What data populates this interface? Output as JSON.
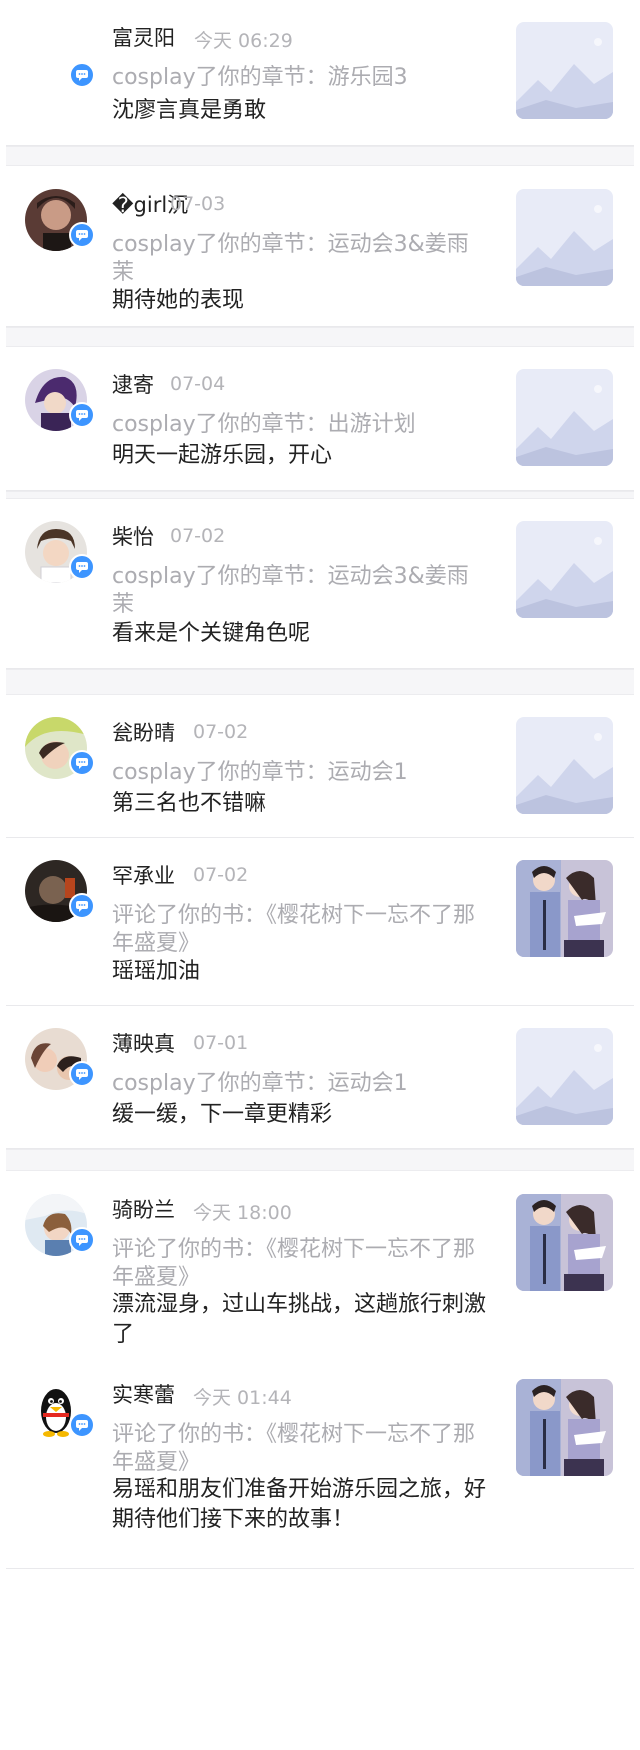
{
  "notifications": [
    {
      "name": "富灵阳",
      "time": "今天 06:29",
      "action": "cosplay了你的章节：游乐园3",
      "text": "沈廖言真是勇敢",
      "avatar": "none",
      "thumb": "placeholder"
    },
    {
      "name": "�girl沉",
      "time": "07-03",
      "action": "cosplay了你的章节：运动会3&姜雨茉",
      "text": "期待她的表现",
      "avatar": "photo",
      "thumb": "placeholder"
    },
    {
      "name": "逮寄",
      "time": "07-04",
      "action": "cosplay了你的章节：出游计划",
      "text": "明天一起游乐园，开心",
      "avatar": "photo",
      "thumb": "placeholder"
    },
    {
      "name": "柴怡",
      "time": "07-02",
      "action": "cosplay了你的章节：运动会3&姜雨茉",
      "text": "看来是个关键角色呢",
      "avatar": "photo",
      "thumb": "placeholder"
    },
    {
      "name": "瓮盼晴",
      "time": "07-02",
      "action": "cosplay了你的章节：运动会1",
      "text": "第三名也不错嘛",
      "avatar": "photo",
      "thumb": "placeholder"
    },
    {
      "name": "罕承业",
      "time": "07-02",
      "action": "评论了你的书：《樱花树下一忘不了那年盛夏》",
      "text": "瑶瑶加油",
      "avatar": "photo",
      "thumb": "cover"
    },
    {
      "name": "薄映真",
      "time": "07-01",
      "action": "cosplay了你的章节：运动会1",
      "text": "缓一缓，下一章更精彩",
      "avatar": "photo",
      "thumb": "placeholder"
    },
    {
      "name": "骑盼兰",
      "time": "今天 18:00",
      "action": "评论了你的书：《樱花树下一忘不了那年盛夏》",
      "text": "漂流湿身，过山车挑战，这趟旅行刺激了",
      "avatar": "photo",
      "thumb": "cover"
    },
    {
      "name": "实寒蕾",
      "time": "今天 01:44",
      "action": "评论了你的书：《樱花树下一忘不了那年盛夏》",
      "text": "易瑶和朋友们准备开始游乐园之旅，好期待他们接下来的故事！",
      "avatar": "penguin",
      "thumb": "cover"
    }
  ],
  "colors": {
    "badge": "#3d95ff",
    "muted": "#acacb1",
    "text": "#222222"
  },
  "icons": {
    "badge": "chat-bubble-icon",
    "thumb_placeholder": "mountain-placeholder-icon",
    "thumb_cover": "book-cover-image"
  }
}
